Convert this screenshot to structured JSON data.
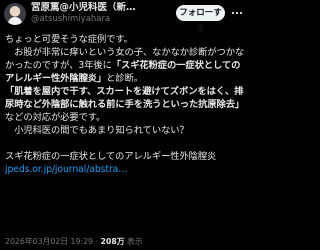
{
  "author": {
    "display_name": "宮原篤@小児科医（新…",
    "handle": "@atsushimiyahara",
    "avatar": "profile-photo"
  },
  "follow_button": {
    "label": "フォローする"
  },
  "more_icon": "more-horizontal-icon",
  "tweet": {
    "p1": "ちょっと可愛そうな症例です。",
    "p2_before": "　お股が非常に痒いという女の子、なかなか診断がつかなかったのですが、3年後に",
    "p2_bold": "「スギ花粉症の一症状としてのアレルギー性外陰膣炎」",
    "p2_after": "と診断。",
    "p3_bold": "「肌着を屋内で干す、スカートを避けてズボンをはく、排尿時など外陰部に触れる前に手を洗うといった抗原除去」",
    "p3_after": "などの対応が必要です。",
    "p4": "　小児科医の間でもあまり知られていない？",
    "p5": "スギ花粉症の一症状としてのアレルギー性外陰膣炎 ",
    "link": "jpeds.or.jp/journal/abstra…"
  },
  "meta": {
    "timestamp": "2026年03月02日 19:29",
    "separator": " · ",
    "views_count": "208万",
    "views_label": " 表示"
  },
  "colors": {
    "background": "#000000",
    "text": "#e7e9ea",
    "secondary_text": "#71767b",
    "link": "#1d9bf0",
    "button_bg": "#eff3f4"
  }
}
